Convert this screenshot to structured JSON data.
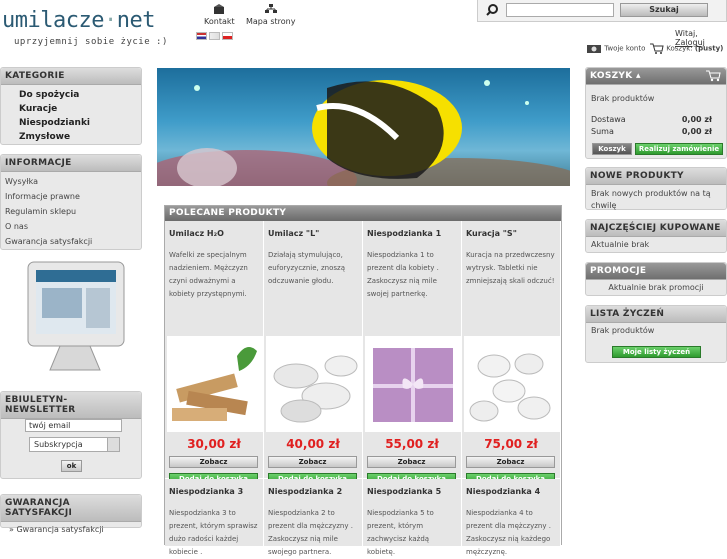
{
  "header": {
    "logo_main": "umilacze",
    "logo_dot": "·",
    "logo_tld": "net",
    "tagline": "uprzyjemnij sobie życie :)",
    "links": [
      {
        "label": "Kontakt",
        "icon": "contact-icon"
      },
      {
        "label": "Mapa strony",
        "icon": "sitemap-icon"
      }
    ],
    "search_button": "Szukaj",
    "greeting": "Witaj,",
    "login_link": "Zaloguj",
    "account_label": "Twoje konto",
    "cart_label": "Koszyk:",
    "cart_status": "(pusty)"
  },
  "left": {
    "categories": {
      "title": "KATEGORIE",
      "items": [
        "Do spożycia",
        "Kuracje",
        "Niespodzianki",
        "Zmysłowe"
      ]
    },
    "info": {
      "title": "INFORMACJE",
      "items": [
        "Wysyłka",
        "Informacje prawne",
        "Regulamin sklepu",
        "O nas",
        "Gwarancja satysfakcji"
      ]
    },
    "newsletter": {
      "title": "EBIULETYN-NEWSLETTER",
      "email": "twój email",
      "select": "Subskrypcja",
      "ok": "ok"
    },
    "guarantee": {
      "title": "GWARANCJA SATYSFAKCJI",
      "item": "Gwarancja satysfakcji"
    }
  },
  "right": {
    "cart": {
      "title": "KOSZYK",
      "empty": "Brak produktów",
      "delivery_label": "Dostawa",
      "delivery_value": "0,00 zł",
      "sum_label": "Suma",
      "sum_value": "0,00 zł",
      "cart_button": "Koszyk",
      "checkout_button": "Realizuj zamówienie"
    },
    "new_products": {
      "title": "NOWE PRODUKTY",
      "text": "Brak nowych produktów na tą chwilę"
    },
    "bestsellers": {
      "title": "NAJCZĘŚCIEJ KUPOWANE",
      "text": "Aktualnie brak"
    },
    "promotions": {
      "title": "PROMOCJE",
      "text": "Aktualnie brak promocji"
    },
    "wishlist": {
      "title": "LISTA ŻYCZEŃ",
      "text": "Brak produktów",
      "button": "Moje listy życzeń"
    }
  },
  "featured": {
    "title": "POLECANE PRODUKTY",
    "view_label": "Zobacz",
    "add_label": "Dodaj do koszyka",
    "products": [
      {
        "name": "Umilacz H₂O",
        "desc": "Wafelki ze specjalnym nadzieniem. Mężczyzn czyni odważnymi a kobiety przystępnymi.",
        "price": "30,00 zł"
      },
      {
        "name": "Umilacz \"L\"",
        "desc": "Działają stymulująco, euforyzycznie, znoszą odczuwanie głodu.",
        "price": "40,00 zł"
      },
      {
        "name": "Niespodzianka 1",
        "desc": "Niespodzianka 1 to prezent dla kobiety . Zaskoczysz nią mile swojej partnerkę.",
        "price": "55,00 zł"
      },
      {
        "name": "Kuracja \"S\"",
        "desc": "Kuracja na przedwczesny wytrysk. Tabletki nie zmniejszają skali odczuć!",
        "price": "75,00 zł"
      }
    ],
    "products2": [
      {
        "name": "Niespodzianka 3",
        "desc": "Niespodzianka 3 to prezent, którym sprawisz dużo radości każdej kobiecie ."
      },
      {
        "name": "Niespodzianka 2",
        "desc": "Niespodzianka 2 to prezent dla mężczyzny . Zaskoczysz nią mile swojego partnera."
      },
      {
        "name": "Niespodzianka 5",
        "desc": "Niespodzianka 5 to prezent, którym zachwycisz każdą kobietę."
      },
      {
        "name": "Niespodzianka 4",
        "desc": "Niespodzianka 4 to prezent dla mężczyzny . Zaskoczysz nią każdego mężczyznę."
      }
    ]
  },
  "colors": {
    "accent_green": "#2f9b2f",
    "price_red": "#e02020",
    "header_gray": "#6f6f6f"
  }
}
